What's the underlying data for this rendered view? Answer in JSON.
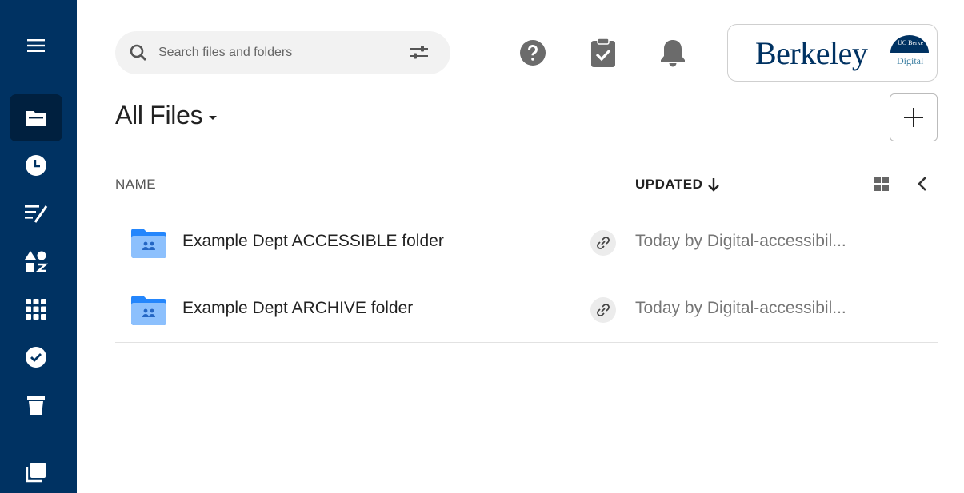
{
  "sidebar": {
    "items": [
      {
        "name": "menu",
        "icon": "hamburger-menu-icon"
      },
      {
        "name": "all-files",
        "icon": "folder-icon",
        "active": true
      },
      {
        "name": "recents",
        "icon": "clock-icon"
      },
      {
        "name": "notes",
        "icon": "notes-icon"
      },
      {
        "name": "apps",
        "icon": "shapes-icon"
      },
      {
        "name": "grid",
        "icon": "grid-icon"
      },
      {
        "name": "tasks",
        "icon": "check-circle-icon"
      },
      {
        "name": "trash",
        "icon": "trash-icon"
      },
      {
        "name": "collections",
        "icon": "copy-icon"
      }
    ]
  },
  "header": {
    "search_placeholder": "Search files and folders",
    "logo_word": "Berkeley",
    "logo_seal_text": "UC Berkeley",
    "logo_sub": "Digital"
  },
  "main": {
    "title": "All Files",
    "columns": {
      "name": "NAME",
      "updated": "UPDATED"
    },
    "rows": [
      {
        "name": "Example Dept ACCESSIBLE folder",
        "updated": "Today by Digital-accessibil..."
      },
      {
        "name": "Example Dept ARCHIVE folder",
        "updated": "Today by Digital-accessibil..."
      }
    ]
  },
  "colors": {
    "sidebar": "#003262",
    "sidebar_active": "#00203f",
    "folder": "#2486fc",
    "icon_gray": "#6b6b6b"
  }
}
